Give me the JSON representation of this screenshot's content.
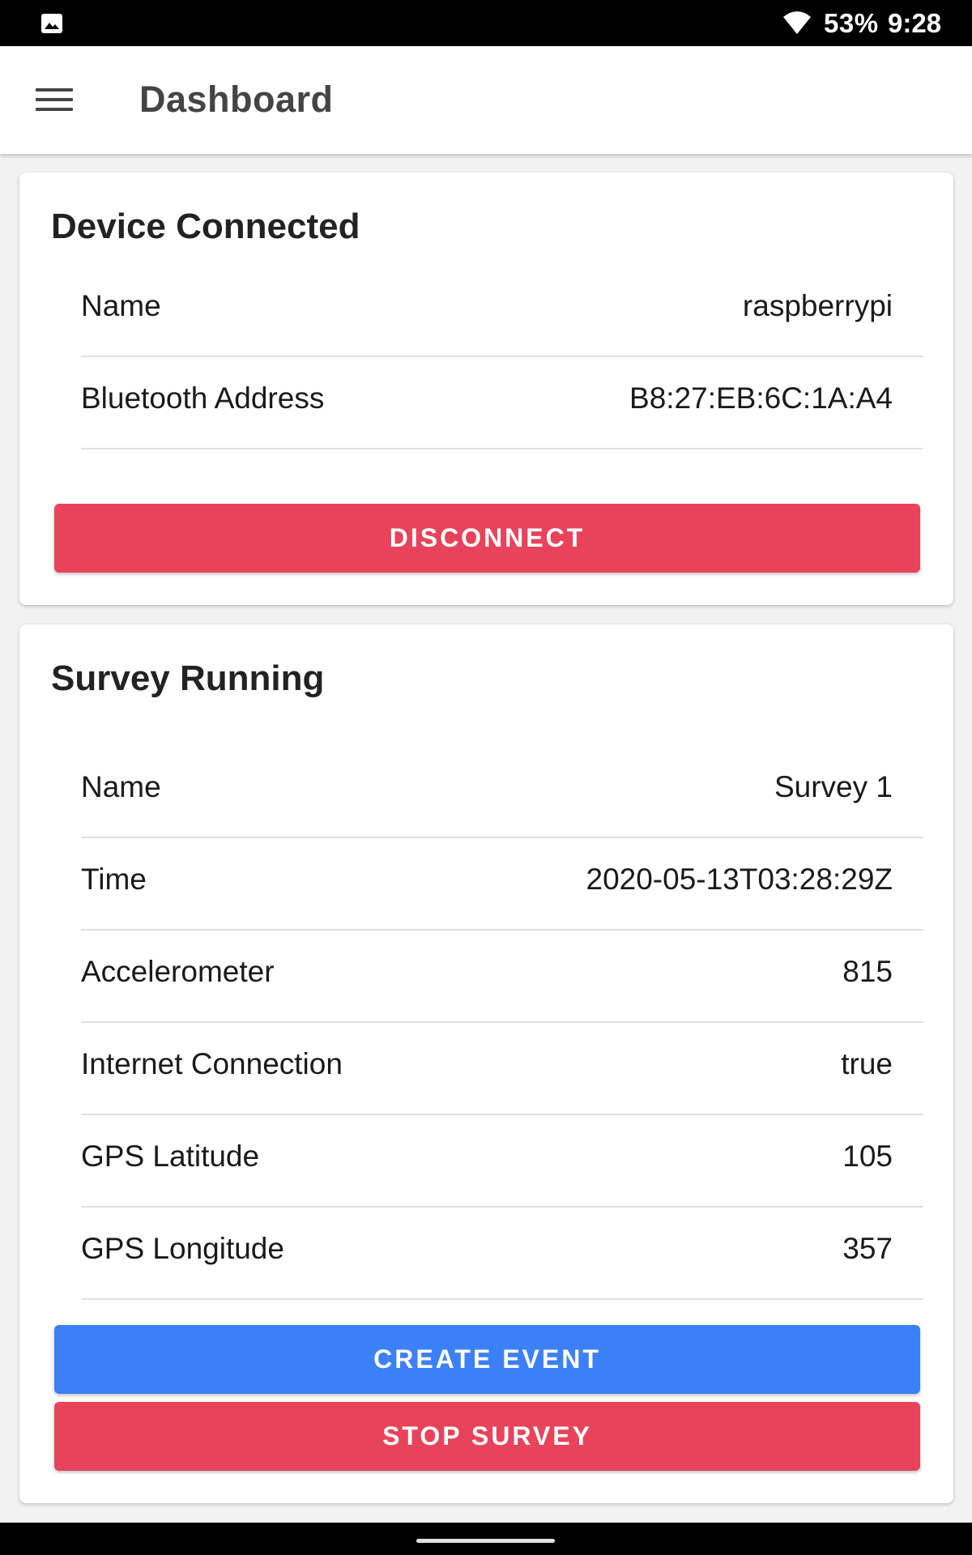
{
  "status_bar": {
    "battery": "53%",
    "time": "9:28"
  },
  "app_bar": {
    "title": "Dashboard"
  },
  "device_card": {
    "title": "Device Connected",
    "rows": [
      {
        "label": "Name",
        "value": "raspberrypi"
      },
      {
        "label": "Bluetooth Address",
        "value": "B8:27:EB:6C:1A:A4"
      }
    ],
    "disconnect_label": "DISCONNECT"
  },
  "survey_card": {
    "title": "Survey Running",
    "rows": [
      {
        "label": "Name",
        "value": "Survey 1"
      },
      {
        "label": "Time",
        "value": "2020-05-13T03:28:29Z"
      },
      {
        "label": "Accelerometer",
        "value": "815"
      },
      {
        "label": "Internet Connection",
        "value": "true"
      },
      {
        "label": "GPS Latitude",
        "value": "105"
      },
      {
        "label": "GPS Longitude",
        "value": "357"
      }
    ],
    "create_event_label": "CREATE EVENT",
    "stop_survey_label": "STOP SURVEY"
  },
  "colors": {
    "danger": "#e8435a",
    "primary": "#3b80f7"
  },
  "icons": {
    "status_left": "photo-icon",
    "status_right": "wifi-icon",
    "app_bar_left": "menu-icon"
  }
}
